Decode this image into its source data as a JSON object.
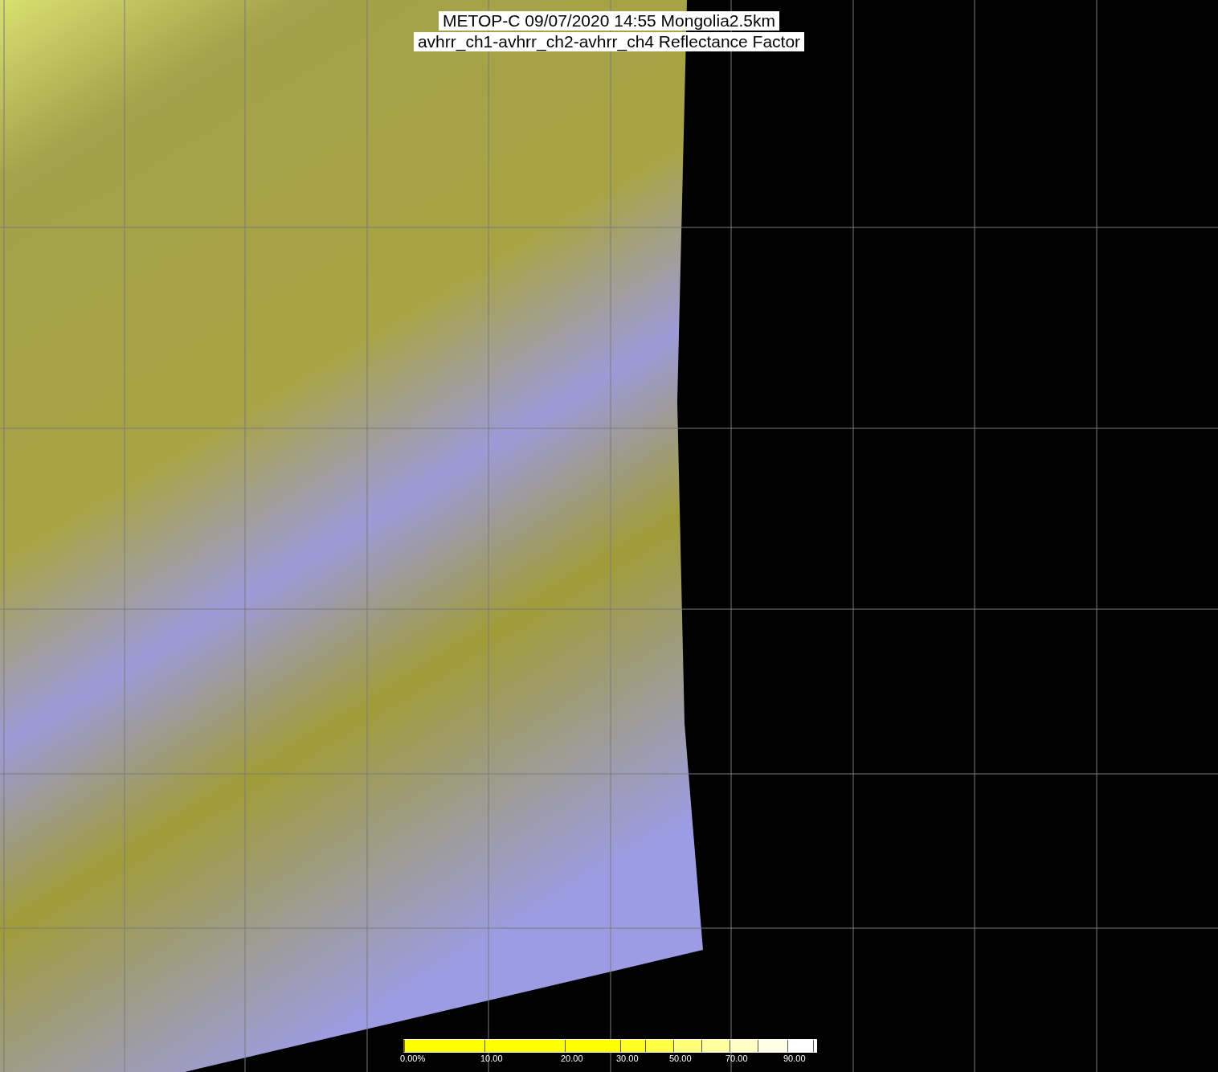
{
  "title": {
    "line_1": "METOP-C 09/07/2020 14:55 Mongolia2.5km",
    "line_2": "avhrr_ch1-avhrr_ch2-avhrr_ch4 Reflectance Factor"
  },
  "legend": {
    "segments": [
      {
        "color": "#ffff00",
        "label": "0.00%"
      },
      {
        "color": "#ffff00",
        "label": "10.00"
      },
      {
        "color": "#ffff00",
        "label": "20.00"
      },
      {
        "color": "#ffff22",
        "label": "30.00"
      },
      {
        "color": "#ffff44"
      },
      {
        "color": "#ffff77",
        "label": "50.00"
      },
      {
        "color": "#ffffa0"
      },
      {
        "color": "#ffffc4",
        "label": "70.00"
      },
      {
        "color": "#ffffe6"
      },
      {
        "color": "#ffffff",
        "label": "90.00"
      }
    ]
  }
}
